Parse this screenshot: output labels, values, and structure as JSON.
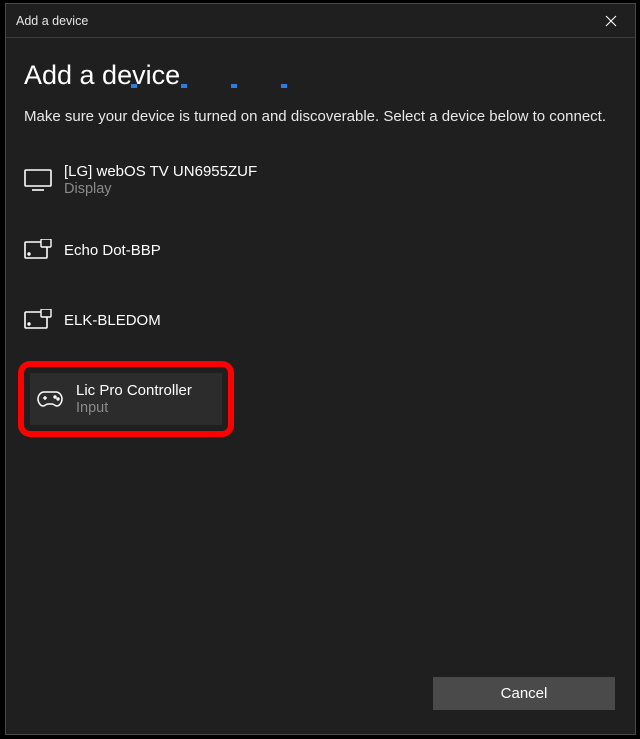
{
  "window": {
    "title": "Add a device"
  },
  "page": {
    "heading": "Add a device",
    "subtext": "Make sure your device is turned on and discoverable. Select a device below to connect."
  },
  "devices": [
    {
      "name": "[LG] webOS TV UN6955ZUF",
      "subtitle": "Display",
      "icon": "display"
    },
    {
      "name": "Echo Dot-BBP",
      "subtitle": "",
      "icon": "generic"
    },
    {
      "name": "ELK-BLEDOM",
      "subtitle": "",
      "icon": "generic"
    },
    {
      "name": "Lic Pro Controller",
      "subtitle": "Input",
      "icon": "gamepad",
      "highlighted": true
    }
  ],
  "buttons": {
    "cancel": "Cancel"
  }
}
